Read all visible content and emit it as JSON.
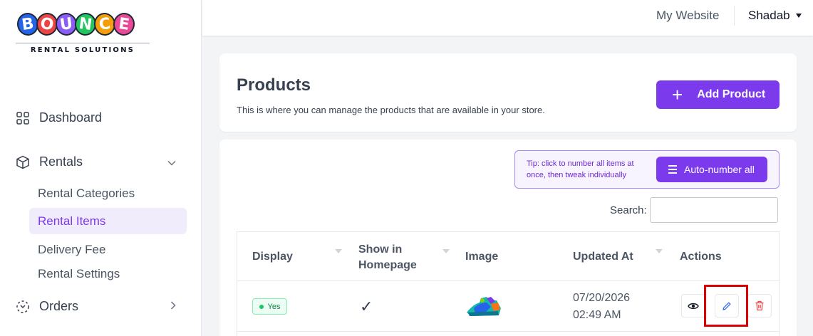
{
  "brand": {
    "letters": [
      "B",
      "O",
      "U",
      "N",
      "C",
      "E"
    ],
    "letter_colors": [
      "#2563eb",
      "#ef4444",
      "#8b5cf6",
      "#22c55e",
      "#f59e0b",
      "#ec4899"
    ],
    "subtitle": "RENTAL SOLUTIONS"
  },
  "sidebar": {
    "dashboard": {
      "label": "Dashboard",
      "icon": "grid-icon"
    },
    "rentals": {
      "label": "Rentals",
      "icon": "box-icon"
    },
    "rental_sub": [
      {
        "label": "Rental Categories"
      },
      {
        "label": "Rental Items",
        "active": true
      },
      {
        "label": "Delivery Fee"
      },
      {
        "label": "Rental Settings"
      }
    ],
    "orders": {
      "label": "Orders",
      "icon": "orders-icon"
    }
  },
  "topbar": {
    "website_link": "My Website",
    "user_name": "Shadab"
  },
  "page": {
    "title": "Products",
    "subtitle": "This is where you can manage the products that are available in your store.",
    "add_button": "Add Product"
  },
  "tip": {
    "text": "Tip: click to number all items at once, then tweak individually",
    "button": "Auto-number all"
  },
  "search": {
    "label": "Search:",
    "value": ""
  },
  "table": {
    "columns": [
      "Display",
      "Show in Homepage",
      "Image",
      "Updated At",
      "Actions"
    ],
    "rows": [
      {
        "display": "Yes",
        "show_in_homepage": "✓",
        "image": "bounce-house-thumbnail",
        "updated_date": "07/20/2026",
        "updated_time": "02:49 AM",
        "actions": [
          "view-icon",
          "edit-icon",
          "delete-icon"
        ]
      }
    ]
  },
  "colors": {
    "accent": "#7c3aed",
    "active_bg": "#f1ecfb",
    "danger": "#ef4444",
    "highlight": "#dc0000"
  }
}
